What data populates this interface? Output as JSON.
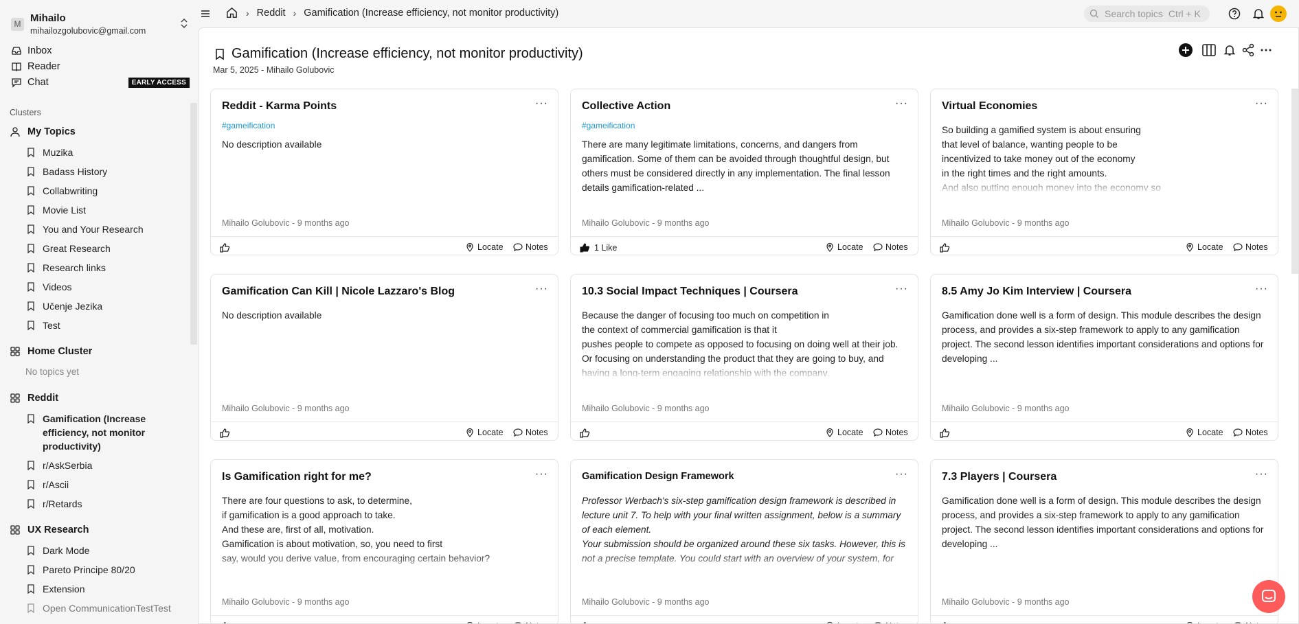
{
  "account": {
    "initial": "M",
    "name": "Mihailo",
    "email": "mihailozgolubovic@gmail.com"
  },
  "nav": [
    {
      "label": "Inbox",
      "icon": "inbox-icon"
    },
    {
      "label": "Reader",
      "icon": "reader-icon"
    },
    {
      "label": "Chat",
      "icon": "chat-icon",
      "badge": "EARLY ACCESS"
    }
  ],
  "clusters_label": "Clusters",
  "clusters": [
    {
      "name": "My Topics",
      "topics": [
        "Muzika",
        "Badass History",
        "Collabwriting",
        "Movie List",
        "You and Your Research",
        "Great Research",
        "Research links",
        "Videos",
        "Učenje Jezika",
        "Test"
      ]
    },
    {
      "name": "Home Cluster",
      "empty": "No topics yet"
    },
    {
      "name": "Reddit",
      "topics": [
        "Gamification (Increase efficiency, not monitor productivity)",
        "r/AskSerbia",
        "r/Ascii",
        "r/Retards"
      ]
    },
    {
      "name": "UX Research",
      "topics": [
        "Dark Mode",
        "Pareto Principe 80/20",
        "Extension",
        "Open CommunicationTestTest"
      ]
    }
  ],
  "breadcrumb": {
    "cluster": "Reddit",
    "topic": "Gamification (Increase efficiency, not monitor productivity)"
  },
  "search": {
    "placeholder": "Search topics",
    "shortcut": "Ctrl + K"
  },
  "page": {
    "title": "Gamification (Increase efficiency, not monitor productivity)",
    "meta": "Mar 5, 2025 - Mihailo Golubovic"
  },
  "card_actions": {
    "locate": "Locate",
    "notes": "Notes"
  },
  "cards": [
    {
      "title": "Reddit - Karma Points",
      "tag": "#gameification",
      "desc": "No description available",
      "author": "Mihailo Golubovic - 9 months ago",
      "likes": ""
    },
    {
      "title": "Collective Action",
      "tag": "#gameification",
      "desc": "There are many legitimate limitations, concerns, and dangers from gamification. Some of them can be avoided through thoughtful design, but others must be considered directly in any implementation. The final lesson details gamification-related ...",
      "author": "Mihailo Golubovic - 9 months ago",
      "likes": "1 Like"
    },
    {
      "title": "Virtual Economies",
      "tag": "",
      "desc": "So building a gamified system is about ensuring\nthat level of balance, wanting people to be\nincentivized to take money out of the economy\nin the right times and the right amounts.\nAnd also putting enough money into the economy so\nthings don't get too expensive and too hard to purchase.",
      "author": "Mihailo Golubovic - 9 months ago",
      "likes": ""
    },
    {
      "title": "Gamification Can Kill | Nicole Lazzaro's Blog",
      "tag": "",
      "desc": "No description available",
      "author": "Mihailo Golubovic - 9 months ago",
      "likes": ""
    },
    {
      "title": "10.3 Social Impact Techniques | Coursera",
      "tag": "",
      "desc": "Because the danger of focusing too much on competition in\nthe context of commercial gamification is that it\npushes people to compete as opposed to focusing on doing well at their job.\nOr focusing on understanding the product that they are going to buy, and\nhaving a long-term engaging relationship with the company.",
      "author": "Mihailo Golubovic - 9 months ago",
      "likes": ""
    },
    {
      "title": "8.5 Amy Jo Kim Interview | Coursera",
      "tag": "",
      "desc": "Gamification done well is a form of design. This module describes the design process, and provides a six-step framework to apply to any gamification project. The second lesson identifies important considerations and options for developing ...",
      "author": "Mihailo Golubovic - 9 months ago",
      "likes": ""
    },
    {
      "title": "Is Gamification right for me?",
      "tag": "",
      "desc": "There are four questions to ask, to determine,\nif gamification is a good approach to take.\nAnd these are, first of all, motivation.\nGamification is about motivation, so, you need to first\nsay, would you derive value, from encouraging certain behavior?\nIf motivation matters to the business problem, it's",
      "author": "Mihailo Golubovic - 9 months ago",
      "likes": ""
    },
    {
      "title": "Gamification Design Framework",
      "tag": "",
      "desc": "Professor Werbach's six-step gamification design framework is described in lecture unit 7. To help with your final written assignment, below is a summary of each element.\nYour submission should be organized around these six tasks. However, this is not a precise template. You could start with an overview of your system, for example. And you don't need to address every specific question below; they",
      "author": "Mihailo Golubovic - 9 months ago",
      "likes": ""
    },
    {
      "title": "7.3 Players | Coursera",
      "tag": "",
      "desc": "Gamification done well is a form of design. This module describes the design process, and provides a six-step framework to apply to any gamification project. The second lesson identifies important considerations and options for developing ...",
      "author": "Mihailo Golubovic - 9 months ago",
      "likes": ""
    }
  ]
}
